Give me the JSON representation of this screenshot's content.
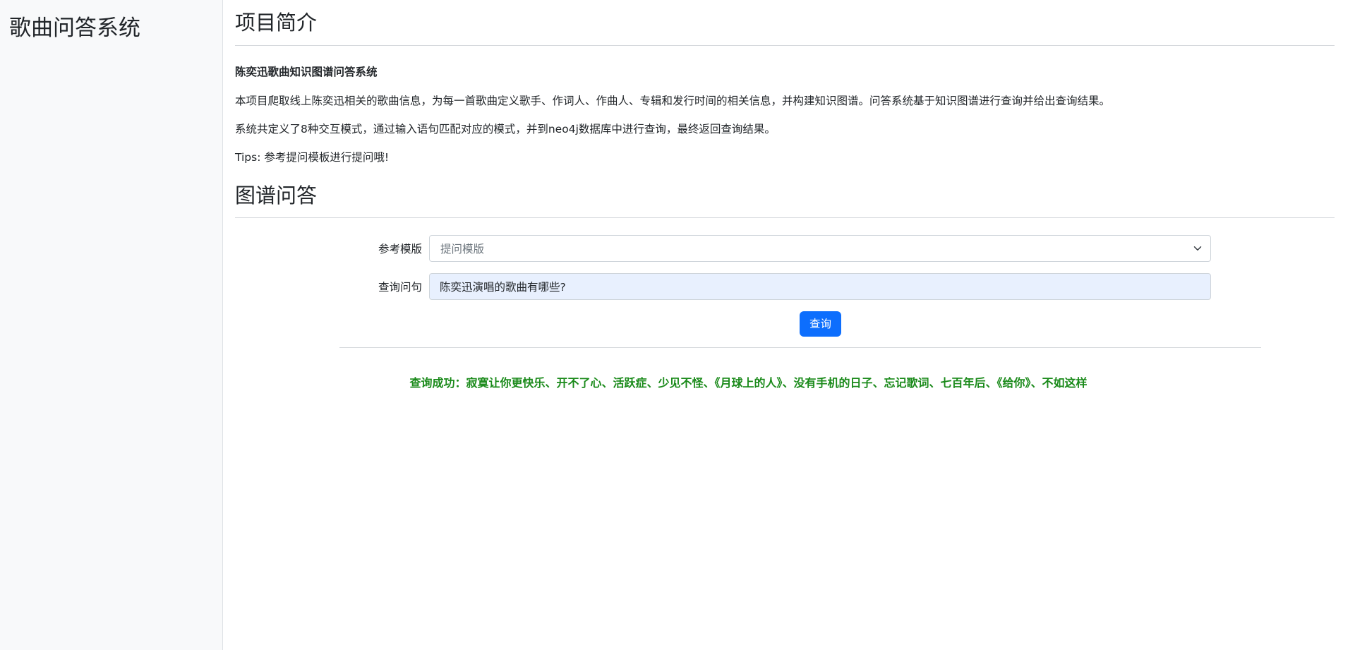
{
  "sidebar": {
    "title": "歌曲问答系统"
  },
  "intro": {
    "section_title": "项目简介",
    "heading": "陈奕迅歌曲知识图谱问答系统",
    "paragraph1": "本项目爬取线上陈奕迅相关的歌曲信息，为每一首歌曲定义歌手、作词人、作曲人、专辑和发行时间的相关信息，并构建知识图谱。问答系统基于知识图谱进行查询并给出查询结果。",
    "paragraph2": "系统共定义了8种交互模式，通过输入语句匹配对应的模式，并到neo4j数据库中进行查询，最终返回查询结果。",
    "tips": "Tips: 参考提问模板进行提问哦!"
  },
  "qa": {
    "section_title": "图谱问答",
    "template_label": "参考模版",
    "template_select_value": "提问模版",
    "query_label": "查询问句",
    "query_value": "陈奕迅演唱的歌曲有哪些?",
    "query_button": "查询",
    "result_text": "查询成功：寂寞让你更快乐、开不了心、活跃症、少见不怪、《月球上的人》、没有手机的日子、忘记歌词、七百年后、《给你》、不如这样"
  },
  "colors": {
    "sidebar_bg": "#f8f9fa",
    "primary": "#0d6efd",
    "success_text": "#1a8a1a",
    "autofill_bg": "#e8f0fe"
  }
}
